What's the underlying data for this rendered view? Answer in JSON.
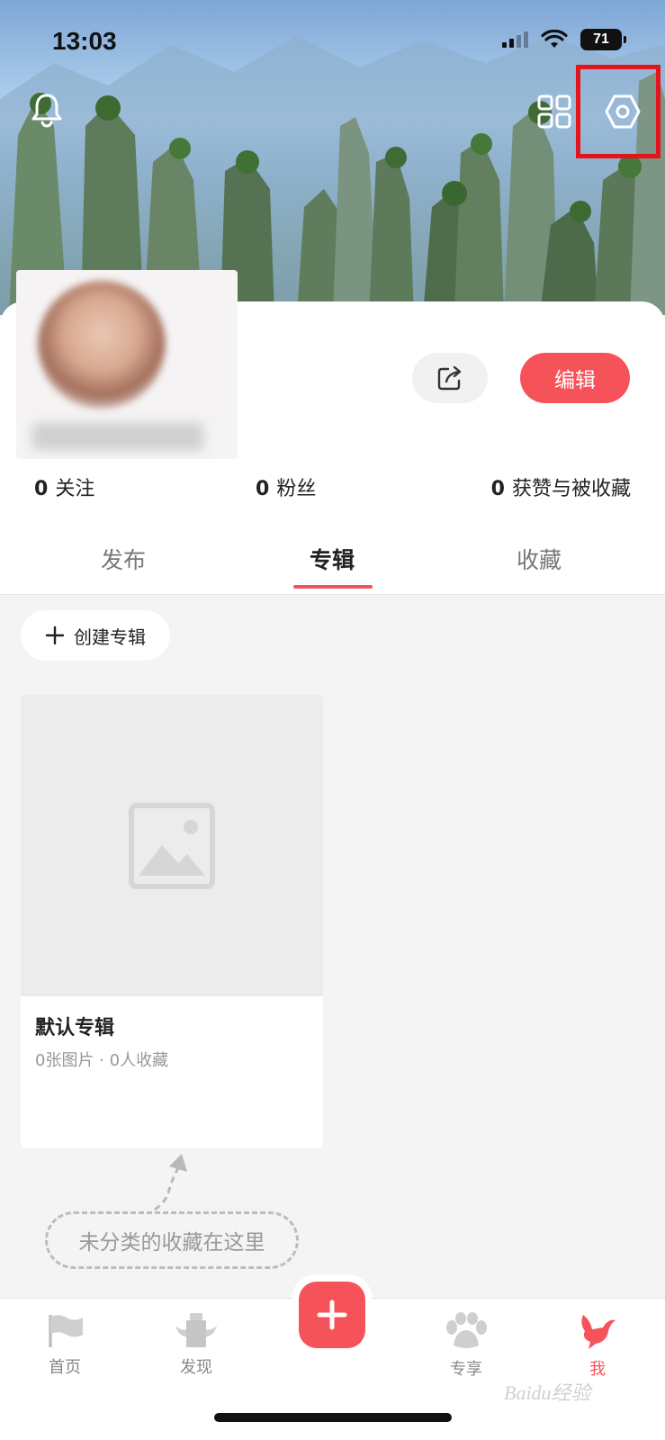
{
  "status_bar": {
    "time": "13:03",
    "battery": "71"
  },
  "profile": {
    "edit_label": "编辑",
    "stats": [
      {
        "count": "0",
        "label": "关注"
      },
      {
        "count": "0",
        "label": "粉丝"
      },
      {
        "count": "0",
        "label": "获赞与被收藏"
      }
    ]
  },
  "tabs": [
    {
      "label": "发布"
    },
    {
      "label": "专辑"
    },
    {
      "label": "收藏"
    }
  ],
  "create_album": {
    "label": "创建专辑"
  },
  "album": {
    "title": "默认专辑",
    "meta": "0张图片 · 0人收藏"
  },
  "hint": {
    "text": "未分类的收藏在这里"
  },
  "bottom_nav": [
    {
      "label": "首页"
    },
    {
      "label": "发现"
    },
    {
      "label": "专享"
    },
    {
      "label": "我"
    }
  ],
  "watermark": "Baidu经验",
  "colors": {
    "accent": "#f6525a",
    "highlight": "#e5131c"
  }
}
